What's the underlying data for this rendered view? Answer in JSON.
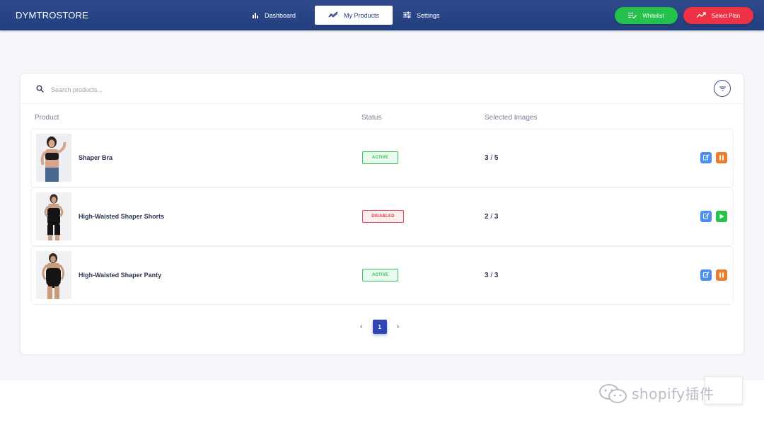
{
  "app": {
    "brand": "DYMTROSTORE"
  },
  "nav": {
    "dashboard": "Dashboard",
    "products": "My Products",
    "settings": "Settings"
  },
  "actions": {
    "whitelist": "Whitelist",
    "select_plan": "Select Plan"
  },
  "search": {
    "placeholder": "Search products..."
  },
  "table": {
    "headers": {
      "product": "Product",
      "status": "Status",
      "images": "Selected Images"
    },
    "rows": [
      {
        "name": "Shaper Bra",
        "status": "ACTIVE",
        "selected": "3",
        "total": "5",
        "state": "active"
      },
      {
        "name": "High-Waisted Shaper Shorts",
        "status": "DISABLED",
        "selected": "2",
        "total": "3",
        "state": "disabled"
      },
      {
        "name": "High-Waisted Shaper Panty",
        "status": "ACTIVE",
        "selected": "3",
        "total": "3",
        "state": "active"
      }
    ]
  },
  "pagination": {
    "current": "1",
    "prev": "‹",
    "next": "›"
  },
  "watermark": "shopify插件",
  "colors": {
    "nav_bg": "#233e7e",
    "active": "#2fc257",
    "disabled": "#e8414f",
    "edit": "#4a8ff0",
    "pause": "#ec7c30",
    "play": "#27c24b"
  }
}
